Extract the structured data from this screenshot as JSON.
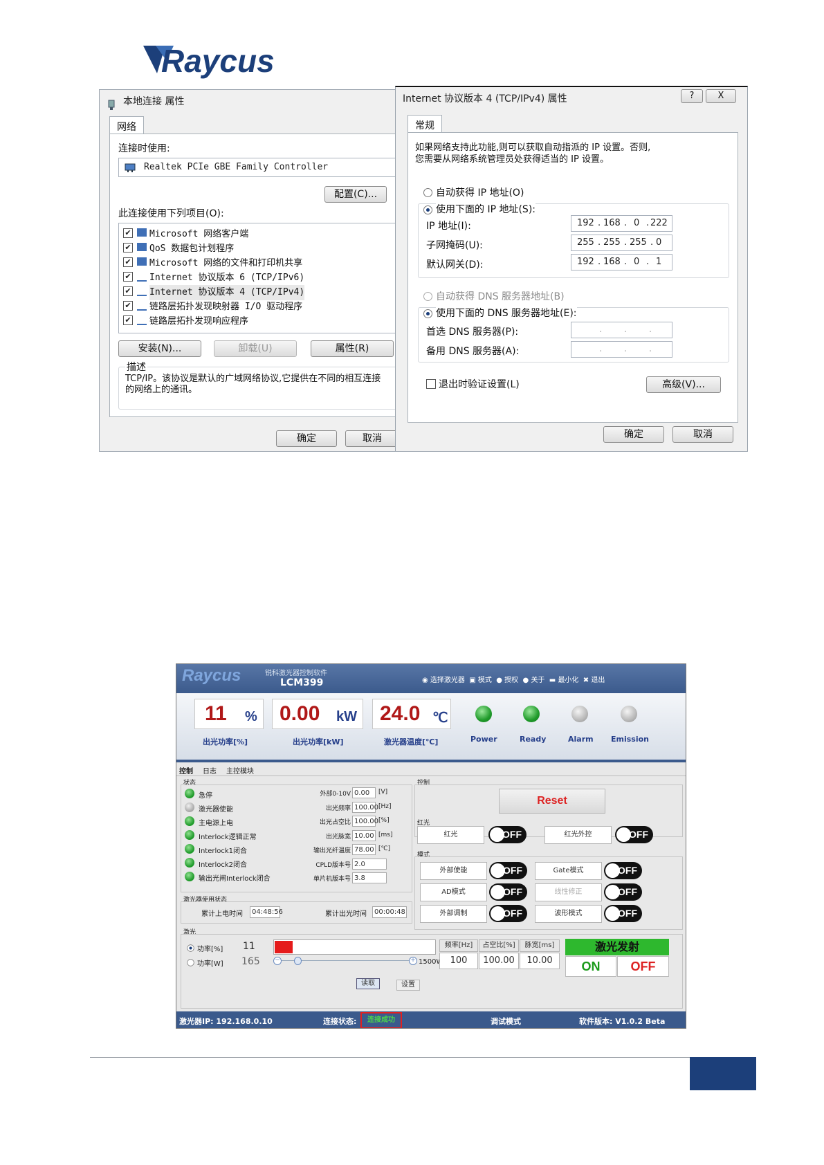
{
  "logo": {
    "text": "Raycus"
  },
  "dialog_left": {
    "title": "本地连接 属性",
    "tab": "网络",
    "connect_using_label": "连接时使用:",
    "adapter": "Realtek PCIe GBE Family Controller",
    "configure_button": "配置(C)...",
    "items_label": "此连接使用下列项目(O):",
    "items": [
      "Microsoft 网络客户端",
      "QoS 数据包计划程序",
      "Microsoft 网络的文件和打印机共享",
      "Internet 协议版本 6 (TCP/IPv6)",
      "Internet 协议版本 4 (TCP/IPv4)",
      "链路层拓扑发现映射器 I/O 驱动程序",
      "链路层拓扑发现响应程序"
    ],
    "install_button": "安装(N)...",
    "uninstall_button": "卸载(U)",
    "properties_button": "属性(R)",
    "description_label": "描述",
    "description": "TCP/IP。该协议是默认的广域网络协议,它提供在不同的相互连接的网络上的通讯。",
    "ok_button": "确定",
    "cancel_button": "取消"
  },
  "dialog_right": {
    "title": "Internet 协议版本 4 (TCP/IPv4) 属性",
    "help_icon": "?",
    "close_icon": "X",
    "tab": "常规",
    "intro_line1": "如果网络支持此功能,则可以获取自动指派的 IP 设置。否则,",
    "intro_line2": "您需要从网络系统管理员处获得适当的 IP 设置。",
    "auto_ip": "自动获得 IP 地址(O)",
    "manual_ip": "使用下面的 IP 地址(S):",
    "ip_label": "IP 地址(I):",
    "ip": [
      "192",
      "168",
      "0",
      "222"
    ],
    "mask_label": "子网掩码(U):",
    "mask": [
      "255",
      "255",
      "255",
      "0"
    ],
    "gateway_label": "默认网关(D):",
    "gateway": [
      "192",
      "168",
      "0",
      "1"
    ],
    "auto_dns": "自动获得 DNS 服务器地址(B)",
    "manual_dns": "使用下面的 DNS 服务器地址(E):",
    "dns1_label": "首选 DNS 服务器(P):",
    "dns2_label": "备用 DNS 服务器(A):",
    "validate_label": "退出时验证设置(L)",
    "advanced_button": "高级(V)...",
    "ok_button": "确定",
    "cancel_button": "取消"
  },
  "software": {
    "logo": "Raycus",
    "subtitle": "锐科激光器控制软件",
    "model": "LCM399",
    "menu": [
      "选择激光器",
      "模式",
      "授权",
      "关于",
      "最小化",
      "退出"
    ],
    "meters": [
      {
        "value": "11",
        "unit": "%",
        "label": "出光功率[%]"
      },
      {
        "value": "0.00",
        "unit": "kW",
        "label": "出光功率[kW]"
      },
      {
        "value": "24.0",
        "unit": "℃",
        "label": "激光器温度[℃]"
      }
    ],
    "indicators": [
      {
        "label": "Power",
        "state": "green"
      },
      {
        "label": "Ready",
        "state": "green"
      },
      {
        "label": "Alarm",
        "state": "grey"
      },
      {
        "label": "Emission",
        "state": "grey"
      }
    ],
    "tabs": [
      "控制",
      "日志",
      "主控模块"
    ],
    "status_group": "状态",
    "status_items": [
      {
        "label": "急停",
        "state": "green"
      },
      {
        "label": "激光器使能",
        "state": "grey"
      },
      {
        "label": "主电源上电",
        "state": "green"
      },
      {
        "label": "Interlock逻辑正常",
        "state": "green"
      },
      {
        "label": "Interlock1闭合",
        "state": "green"
      },
      {
        "label": "Interlock2闭合",
        "state": "green"
      },
      {
        "label": "输出光闸Interlock闭合",
        "state": "green"
      }
    ],
    "params": [
      {
        "label": "外部0-10V",
        "value": "0.00",
        "unit": "[V]"
      },
      {
        "label": "出光频率",
        "value": "100.00",
        "unit": "[Hz]"
      },
      {
        "label": "出光占空比",
        "value": "100.00",
        "unit": "[%]"
      },
      {
        "label": "出光脉宽",
        "value": "10.00",
        "unit": "[ms]"
      },
      {
        "label": "输出光纤温度",
        "value": "78.00",
        "unit": "[℃]"
      },
      {
        "label": "CPLD版本号",
        "value": "2.0",
        "unit": ""
      },
      {
        "label": "单片机版本号",
        "value": "3.8",
        "unit": ""
      }
    ],
    "usage_group": "激光器使用状态",
    "power_on_time_label": "累计上电时间",
    "power_on_time": "04:48:56",
    "emission_time_label": "累计出光时间",
    "emission_time": "00:00:48",
    "control_group": "控制",
    "reset_button": "Reset",
    "red_light_group": "红光",
    "red_light": "红光",
    "red_light_ext": "红光外控",
    "mode_group": "模式",
    "modes": [
      "外部使能",
      "Gate模式",
      "AD模式",
      "线性修正",
      "外部调制",
      "波形模式"
    ],
    "toggle_off": "OFF",
    "laser_group": "激光",
    "power_pct_label": "功率[%]",
    "power_pct_value": "11",
    "power_w_label": "功率[W]",
    "power_w_value": "165",
    "power_max": "1500W",
    "freq_label": "频率[Hz]",
    "freq_value": "100",
    "duty_label": "占空比[%]",
    "duty_value": "100.00",
    "pulse_label": "脉宽[ms]",
    "pulse_value": "10.00",
    "read_button": "读取",
    "set_button": "设置",
    "emit_label": "激光发射",
    "on_label": "ON",
    "off_label": "OFF",
    "status_ip": "激光器IP:  192.168.0.10",
    "conn_label": "连接状态:",
    "conn_value": "连接成功",
    "debug_mode": "调试模式",
    "version": "软件版本:  V1.0.2 Beta"
  },
  "colors": {
    "brand": "#1c3f7a",
    "value_red": "#b01818",
    "emit_green": "#2eb82e",
    "highlight_red": "#d22"
  }
}
